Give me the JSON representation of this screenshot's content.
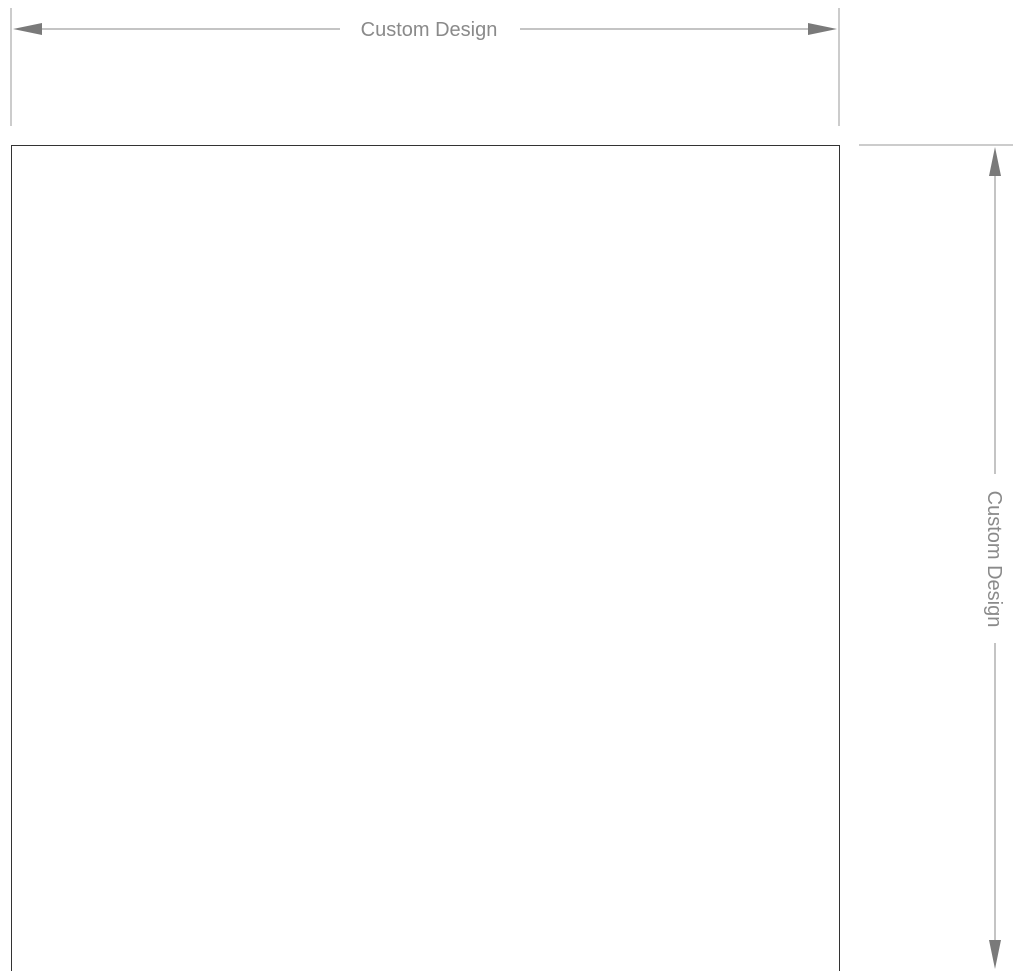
{
  "width_dimension": {
    "label": "Custom Design"
  },
  "height_dimension": {
    "label": "Custom Design"
  },
  "colors": {
    "dimension_line": "#8a8a8a",
    "dimension_arrow": "#7a7a7a",
    "panel_border": "#333333",
    "background": "#ffffff"
  }
}
